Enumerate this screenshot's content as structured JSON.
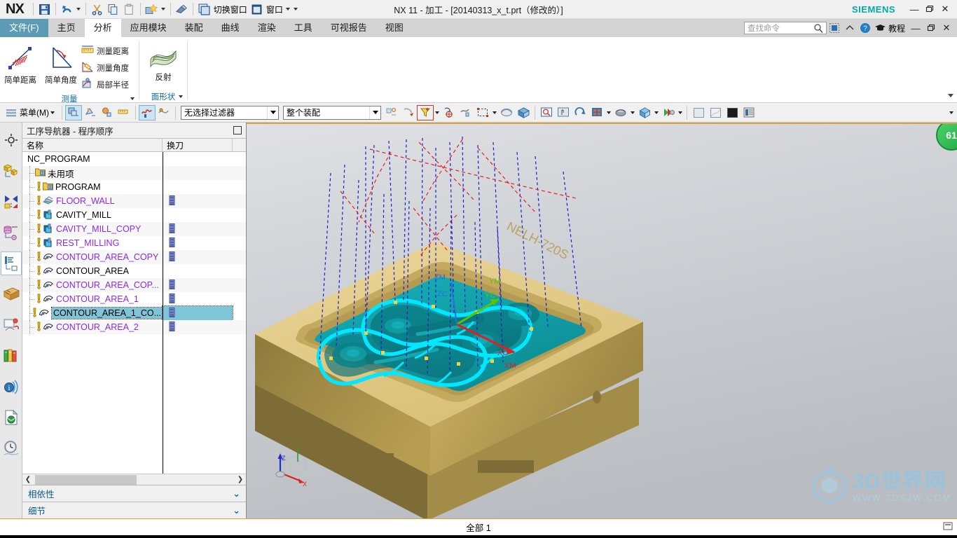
{
  "titlebar": {
    "logo": "NX",
    "title": "NX 11 - 加工 - [20140313_x_t.prt（修改的）]",
    "brand": "SIEMENS",
    "quick_access": [
      {
        "name": "save-icon",
        "label": ""
      },
      {
        "name": "undo-icon",
        "label": ""
      },
      {
        "name": "cut-icon",
        "label": ""
      },
      {
        "name": "copy-icon",
        "label": ""
      },
      {
        "name": "paste-icon",
        "label": ""
      },
      {
        "name": "favorites-icon",
        "label": ""
      },
      {
        "name": "eraser-icon",
        "label": ""
      }
    ],
    "switch_window_label": "切换窗口",
    "window_label": "窗口",
    "minimize": "—",
    "restore": "▫",
    "close": "✕"
  },
  "tabs": [
    {
      "label": "文件(F)",
      "state": "file"
    },
    {
      "label": "主页",
      "state": "normal"
    },
    {
      "label": "分析",
      "state": "active"
    },
    {
      "label": "应用模块",
      "state": "normal"
    },
    {
      "label": "装配",
      "state": "normal"
    },
    {
      "label": "曲线",
      "state": "normal"
    },
    {
      "label": "渲染",
      "state": "normal"
    },
    {
      "label": "工具",
      "state": "normal"
    },
    {
      "label": "可视报告",
      "state": "normal"
    },
    {
      "label": "视图",
      "state": "normal"
    }
  ],
  "search": {
    "placeholder": "查找命令",
    "icon": "search-icon"
  },
  "tab_right_icons": [
    {
      "name": "window-mode-icon"
    },
    {
      "name": "collapse-ribbon-icon"
    },
    {
      "name": "help-icon"
    },
    {
      "name": "graduation-cap-icon"
    }
  ],
  "tutorial_label": "教程",
  "ribbon": {
    "groups": [
      {
        "label": "测量",
        "big_buttons": [
          {
            "label": "简单距离",
            "icon": "simple-distance-icon"
          },
          {
            "label": "简单角度",
            "icon": "simple-angle-icon"
          }
        ],
        "small_buttons": [
          {
            "label": "测量距离",
            "icon": "measure-distance-icon"
          },
          {
            "label": "测量角度",
            "icon": "measure-angle-icon"
          },
          {
            "label": "局部半径",
            "icon": "local-radius-icon"
          }
        ]
      },
      {
        "label": "面形状",
        "big_buttons": [
          {
            "label": "反射",
            "icon": "reflection-icon"
          }
        ],
        "small_buttons": []
      }
    ]
  },
  "selection_bar": {
    "menu_label": "菜单(M)",
    "filter_combo": "无选择过滤器",
    "scope_combo": "整个装配",
    "icons_left": [
      {
        "name": "select-general-icon",
        "active": true
      },
      {
        "name": "select-feature-icon",
        "active": false
      },
      {
        "name": "select-face-icon",
        "active": false
      },
      {
        "name": "select-edge-icon",
        "active": false
      },
      {
        "name": "curve-rule-icon",
        "active": true
      },
      {
        "name": "stop-at-intersection-icon",
        "active": false
      }
    ],
    "icons_right": [
      {
        "name": "snap-point-icon"
      },
      {
        "name": "snap-arc-center-icon"
      },
      {
        "name": "snap-filter-icon",
        "highlighted": true
      },
      {
        "name": "point-constructor-icon"
      },
      {
        "name": "move-object-icon"
      },
      {
        "name": "rectangle-select-icon"
      },
      {
        "name": "show-hide-icon"
      },
      {
        "name": "view-orient-icon"
      },
      {
        "name": "zoom-window-icon"
      },
      {
        "name": "pan-icon"
      },
      {
        "name": "rotate-icon"
      },
      {
        "name": "fit-view-icon"
      },
      {
        "name": "shaded-style-icon"
      },
      {
        "name": "render-style-icon"
      },
      {
        "name": "color-display-icon"
      },
      {
        "name": "background1-icon"
      },
      {
        "name": "background2-icon"
      },
      {
        "name": "background3-icon"
      },
      {
        "name": "layer-settings-icon"
      }
    ]
  },
  "icon_rail": [
    {
      "name": "part-navigator-icon",
      "selected": false
    },
    {
      "name": "assembly-navigator-icon",
      "selected": false
    },
    {
      "name": "constraint-navigator-icon",
      "selected": false
    },
    {
      "name": "machining-feature-icon",
      "selected": false
    },
    {
      "name": "operation-navigator-icon",
      "selected": true
    },
    {
      "name": "reuse-library-icon",
      "selected": false
    },
    {
      "name": "web-browser-icon",
      "selected": false
    },
    {
      "name": "history-library-icon",
      "selected": false
    },
    {
      "name": "process-studio-icon",
      "selected": false
    },
    {
      "name": "internet-explorer-icon",
      "selected": false
    },
    {
      "name": "history-icon",
      "selected": false
    }
  ],
  "navigator": {
    "title": "工序导航器 - 程序顺序",
    "pin_icon": "pin-icon",
    "columns": [
      "名称",
      "换刀"
    ],
    "rows": [
      {
        "label": "NC_PROGRAM",
        "depth": 0,
        "icon": "none",
        "color": "black",
        "warn": false,
        "tool": false,
        "selected": false
      },
      {
        "label": "未用项",
        "depth": 1,
        "icon": "folder",
        "color": "black",
        "warn": false,
        "tool": false,
        "selected": false
      },
      {
        "label": "PROGRAM",
        "depth": 2,
        "icon": "folder",
        "color": "black",
        "warn": true,
        "tool": false,
        "selected": false
      },
      {
        "label": "FLOOR_WALL",
        "depth": 2,
        "icon": "floorwall",
        "color": "purple",
        "warn": true,
        "tool": true,
        "selected": false
      },
      {
        "label": "CAVITY_MILL",
        "depth": 2,
        "icon": "cavity",
        "color": "black",
        "warn": true,
        "tool": false,
        "selected": false
      },
      {
        "label": "CAVITY_MILL_COPY",
        "depth": 2,
        "icon": "cavity",
        "color": "purple",
        "warn": true,
        "tool": true,
        "selected": false
      },
      {
        "label": "REST_MILLING",
        "depth": 2,
        "icon": "cavity",
        "color": "purple",
        "warn": true,
        "tool": true,
        "selected": false
      },
      {
        "label": "CONTOUR_AREA_COPY",
        "depth": 2,
        "icon": "contour",
        "color": "purple",
        "warn": true,
        "tool": true,
        "selected": false
      },
      {
        "label": "CONTOUR_AREA",
        "depth": 2,
        "icon": "contour",
        "color": "black",
        "warn": true,
        "tool": false,
        "selected": false
      },
      {
        "label": "CONTOUR_AREA_COP...",
        "depth": 2,
        "icon": "contour",
        "color": "purple",
        "warn": true,
        "tool": true,
        "selected": false
      },
      {
        "label": "CONTOUR_AREA_1",
        "depth": 2,
        "icon": "contour",
        "color": "purple",
        "warn": true,
        "tool": true,
        "selected": false
      },
      {
        "label": "CONTOUR_AREA_1_CO...",
        "depth": 2,
        "icon": "contour",
        "color": "black",
        "warn": true,
        "tool": true,
        "selected": true
      },
      {
        "label": "CONTOUR_AREA_2",
        "depth": 2,
        "icon": "contour",
        "color": "purple",
        "warn": true,
        "tool": true,
        "selected": false
      }
    ],
    "panels": [
      {
        "label": "相依性",
        "chevron": "⌄"
      },
      {
        "label": "细节",
        "chevron": "⌄"
      }
    ],
    "hscroll": {
      "left": "❮",
      "right": "❯"
    }
  },
  "viewport": {
    "badge": "61",
    "triad": {
      "x": "X",
      "y": "Y",
      "z": "Z"
    },
    "csys_labels": [
      "XM",
      "YM",
      "ZM",
      "XC",
      "YC",
      "ZC"
    ],
    "engrave_text": "NELH-720S",
    "watermark": {
      "main": "3D世界网",
      "sub": "WWW.3DSJW.COM",
      "logo": "cube-logo-icon"
    },
    "colors": {
      "stock_top": "#e3ce86",
      "stock_side": "#cdb466",
      "stock_dark": "#8f7a3c",
      "cavity": "#12a0a8",
      "toolpath_cyan": "#00e5ff",
      "toolpath_blue": "#2222dd",
      "toolpath_red": "#dd2222",
      "bg_top": "#d8dadd",
      "bg_bottom": "#bfc3c8"
    }
  },
  "statusbar": {
    "text": "全部 1",
    "right_icon": "status-right-icon"
  }
}
